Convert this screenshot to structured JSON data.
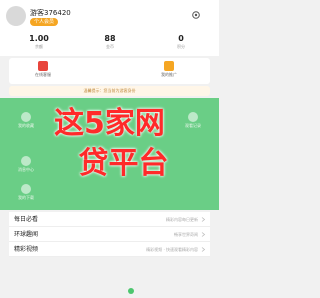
{
  "profile": {
    "username": "游客376420",
    "member_badge": "个人会员"
  },
  "stats": [
    {
      "value": "1.00",
      "label": "余额"
    },
    {
      "value": "88",
      "label": "金币"
    },
    {
      "value": "0",
      "label": "积分"
    }
  ],
  "shortcuts": [
    {
      "label": "在线客服",
      "icon": "service-icon",
      "color": "#e8453c"
    },
    {
      "label": "我的推广",
      "icon": "share-icon",
      "color": "#f5a623"
    }
  ],
  "notice": "温馨提示：您当前为游客身份",
  "under_overlay_items": [
    {
      "label": "我的收藏",
      "icon": "favorite-icon"
    },
    {
      "label": "观看记录",
      "icon": "history-icon"
    },
    {
      "label": "消息中心",
      "icon": "message-icon"
    },
    {
      "label": "我的下载",
      "icon": "download-icon"
    }
  ],
  "overlay": {
    "line1": "这5家网",
    "line2": "贷平台",
    "color": "#ff2a2a"
  },
  "menu": [
    {
      "title": "每日必看",
      "hint": "精彩内容每日更新"
    },
    {
      "title": "环球趣闻",
      "hint": "畅享世界奇闻"
    },
    {
      "title": "精彩视频",
      "hint": "精彩视频 · 快速观看精彩内容"
    }
  ],
  "colors": {
    "accent_green": "#4cc66e",
    "badge_orange": "#f5a623"
  }
}
